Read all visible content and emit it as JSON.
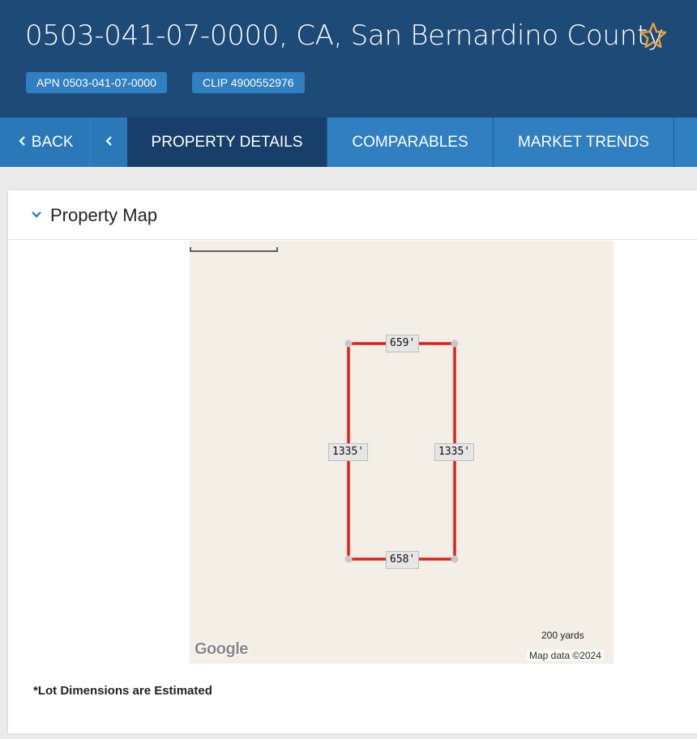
{
  "header": {
    "title": "0503-041-07-0000, CA, San Bernardino County",
    "apn_badge": "APN 0503-041-07-0000",
    "clip_badge": "CLIP 4900552976",
    "colors": {
      "background": "#1e4a78",
      "badge": "#2f7fc1",
      "star": "#f0a030"
    }
  },
  "nav": {
    "back_label": "BACK",
    "tabs": [
      {
        "label": "PROPERTY DETAILS",
        "active": true
      },
      {
        "label": "COMPARABLES",
        "active": false
      },
      {
        "label": "MARKET TRENDS",
        "active": false
      }
    ]
  },
  "card": {
    "title": "Property Map",
    "footnote": "*Lot Dimensions are Estimated"
  },
  "map": {
    "dimensions": {
      "top": "659'",
      "bottom": "658'",
      "left": "1335'",
      "right": "1335'"
    },
    "scale_label": "200 yards",
    "attribution": "Map data ©2024",
    "logo": "Google",
    "boundary_color": "#e0201b"
  }
}
